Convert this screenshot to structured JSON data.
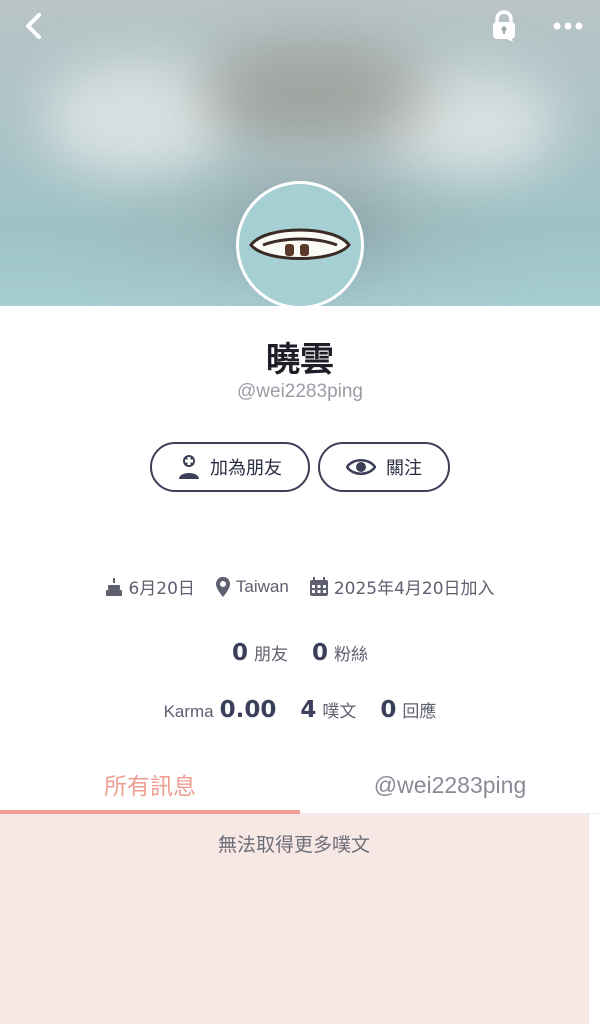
{
  "profile": {
    "display_name": "曉雲",
    "handle": "@wei2283ping"
  },
  "actions": {
    "add_friend_label": "加為朋友",
    "follow_label": "關注"
  },
  "meta": {
    "birthday": "6月20日",
    "location": "Taiwan",
    "joined": "2025年4月20日加入"
  },
  "stats": {
    "friends_count": "0",
    "friends_label": "朋友",
    "fans_count": "0",
    "fans_label": "粉絲",
    "karma_label": "Karma",
    "karma_value": "0.00",
    "plurks_count": "4",
    "plurks_label": "噗文",
    "replies_count": "0",
    "replies_label": "回應"
  },
  "tabs": [
    {
      "label": "所有訊息",
      "active": true
    },
    {
      "label": "@wei2283ping",
      "active": false
    }
  ],
  "content": {
    "empty_message": "無法取得更多噗文"
  },
  "colors": {
    "accent": "#ef9e93",
    "button_border": "#3c3f57",
    "content_bg": "#f7e7e5"
  },
  "icons": [
    "back-icon",
    "lock-icon",
    "more-icon",
    "add-user-icon",
    "eye-icon",
    "cake-icon",
    "location-pin-icon",
    "calendar-icon"
  ]
}
